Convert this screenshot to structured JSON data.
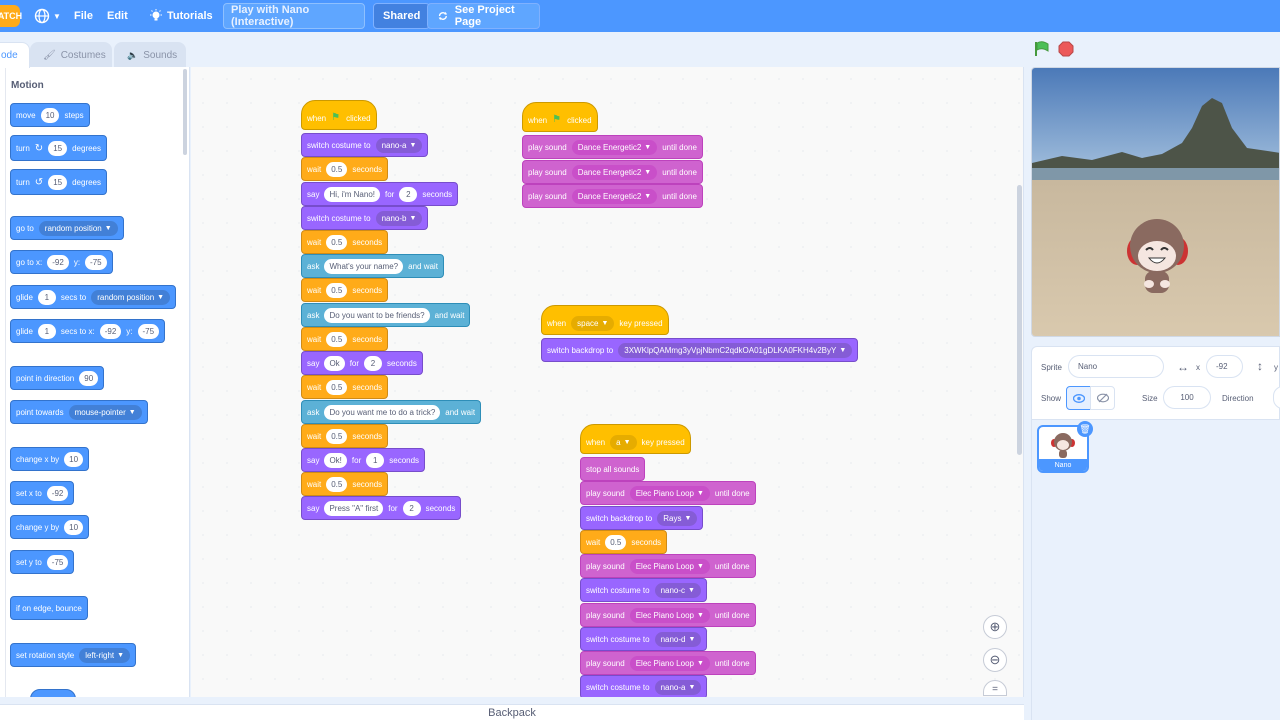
{
  "menu": {
    "logo": "ATCH",
    "file": "File",
    "edit": "Edit",
    "tutorials": "Tutorials",
    "project_title": "Play with Nano (Interactive)",
    "shared": "Shared",
    "see_project_page": "See Project Page"
  },
  "tabs": {
    "code": "ode",
    "costumes": "Costumes",
    "sounds": "Sounds"
  },
  "palette": {
    "category": "Motion",
    "move": {
      "label": "move",
      "steps": "10",
      "suffix": "steps"
    },
    "turn_right": {
      "label": "turn",
      "degrees": "15",
      "suffix": "degrees"
    },
    "turn_left": {
      "label": "turn",
      "degrees": "15",
      "suffix": "degrees"
    },
    "goto": {
      "label": "go to",
      "option": "random position"
    },
    "gotoxy": {
      "label": "go to x:",
      "x": "-92",
      "ylabel": "y:",
      "y": "-75"
    },
    "glide_to": {
      "label": "glide",
      "secs": "1",
      "mid": "secs to",
      "option": "random position"
    },
    "glide_xy": {
      "label": "glide",
      "secs": "1",
      "mid": "secs to x:",
      "x": "-92",
      "ylabel": "y:",
      "y": "-75"
    },
    "point_dir": {
      "label": "point in direction",
      "value": "90"
    },
    "point_towards": {
      "label": "point towards",
      "option": "mouse-pointer"
    },
    "change_x": {
      "label": "change x by",
      "value": "10"
    },
    "set_x": {
      "label": "set x to",
      "value": "-92"
    },
    "change_y": {
      "label": "change y by",
      "value": "10"
    },
    "set_y": {
      "label": "set y to",
      "value": "-75"
    },
    "bounce": {
      "label": "if on edge, bounce"
    },
    "rotation": {
      "label": "set rotation style",
      "option": "left-right"
    }
  },
  "script1": {
    "hat": {
      "when": "when",
      "clicked": "clicked"
    },
    "b1": {
      "label": "switch costume to",
      "option": "nano-a"
    },
    "b2": {
      "label": "wait",
      "value": "0.5",
      "suffix": "seconds"
    },
    "b3": {
      "label": "say",
      "text": "Hi, i'm Nano!",
      "for": "for",
      "secs": "2",
      "suffix": "seconds"
    },
    "b4": {
      "label": "switch costume to",
      "option": "nano-b"
    },
    "b5": {
      "label": "wait",
      "value": "0.5",
      "suffix": "seconds"
    },
    "b6": {
      "label": "ask",
      "text": "What's your name?",
      "suffix": "and wait"
    },
    "b7": {
      "label": "wait",
      "value": "0.5",
      "suffix": "seconds"
    },
    "b8": {
      "label": "ask",
      "text": "Do you want to be friends?",
      "suffix": "and wait"
    },
    "b9": {
      "label": "wait",
      "value": "0.5",
      "suffix": "seconds"
    },
    "b10": {
      "label": "say",
      "text": "Ok",
      "for": "for",
      "secs": "2",
      "suffix": "seconds"
    },
    "b11": {
      "label": "wait",
      "value": "0.5",
      "suffix": "seconds"
    },
    "b12": {
      "label": "ask",
      "text": "Do you want me to do a trick?",
      "suffix": "and wait"
    },
    "b13": {
      "label": "wait",
      "value": "0.5",
      "suffix": "seconds"
    },
    "b14": {
      "label": "say",
      "text": "Ok!",
      "for": "for",
      "secs": "1",
      "suffix": "seconds"
    },
    "b15": {
      "label": "wait",
      "value": "0.5",
      "suffix": "seconds"
    },
    "b16": {
      "label": "say",
      "text": "Press \"A\" first",
      "for": "for",
      "secs": "2",
      "suffix": "seconds"
    }
  },
  "script2": {
    "hat": {
      "when": "when",
      "clicked": "clicked"
    },
    "b1": {
      "label": "play sound",
      "option": "Dance Energetic2",
      "suffix": "until done"
    },
    "b2": {
      "label": "play sound",
      "option": "Dance Energetic2",
      "suffix": "until done"
    },
    "b3": {
      "label": "play sound",
      "option": "Dance Energetic2",
      "suffix": "until done"
    }
  },
  "script3": {
    "hat": {
      "when": "when",
      "key": "space",
      "suffix": "key pressed"
    },
    "b1": {
      "label": "switch backdrop to",
      "option": "3XWKlpQAMmg3yVpjNbmC2qdkOA01gDLKA0FKH4v2ByY"
    }
  },
  "script4": {
    "hat": {
      "when": "when",
      "key": "a",
      "suffix": "key pressed"
    },
    "b1": {
      "label": "stop all sounds"
    },
    "b2": {
      "label": "play sound",
      "option": "Elec Piano Loop",
      "suffix": "until done"
    },
    "b3": {
      "label": "switch backdrop to",
      "option": "Rays"
    },
    "b4": {
      "label": "wait",
      "value": "0.5",
      "suffix": "seconds"
    },
    "b5": {
      "label": "play sound",
      "option": "Elec Piano Loop",
      "suffix": "until done"
    },
    "b6": {
      "label": "switch costume to",
      "option": "nano-c"
    },
    "b7": {
      "label": "play sound",
      "option": "Elec Piano Loop",
      "suffix": "until done"
    },
    "b8": {
      "label": "switch costume to",
      "option": "nano-d"
    },
    "b9": {
      "label": "play sound",
      "option": "Elec Piano Loop",
      "suffix": "until done"
    },
    "b10": {
      "label": "switch costume to",
      "option": "nano-a"
    }
  },
  "footer": {
    "backpack": "Backpack"
  },
  "sprite": {
    "sprite_label": "Sprite",
    "name": "Nano",
    "x_label": "x",
    "x": "-92",
    "y_label": "y",
    "show_label": "Show",
    "size_label": "Size",
    "size": "100",
    "direction_label": "Direction",
    "thumb_name": "Nano"
  },
  "colors": {
    "accent": "#4c97ff",
    "motion": "#4c97ff",
    "looks": "#9966ff",
    "sound": "#cf63cf",
    "events": "#ffbf00",
    "control": "#ffab19",
    "sensing": "#5cb1d6"
  }
}
